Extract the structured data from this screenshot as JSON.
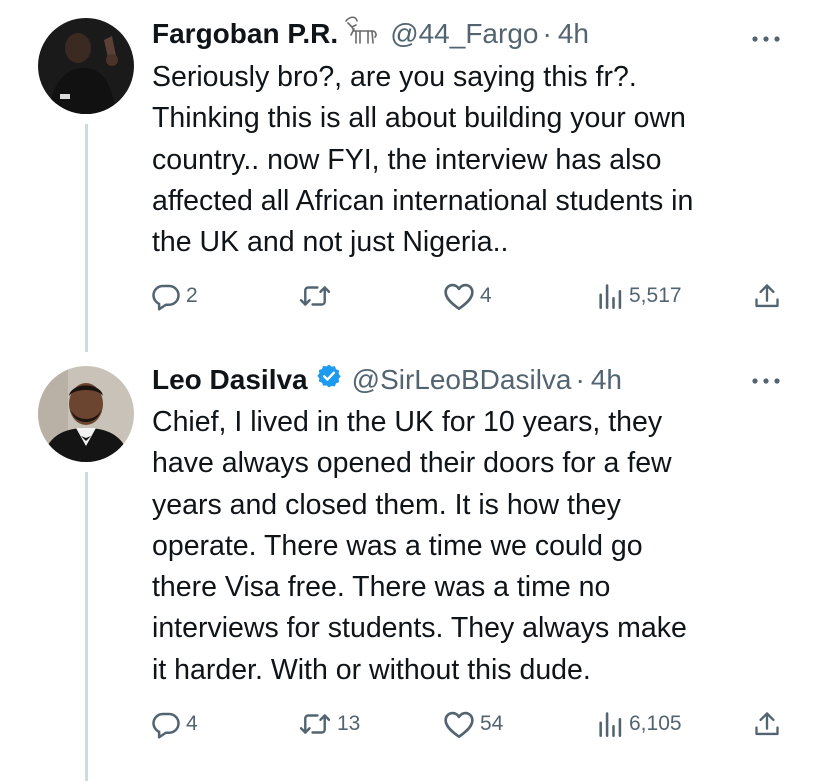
{
  "tweets": [
    {
      "display_name": "Fargoban P.R.",
      "name_emoji": "goat-emoji",
      "handle": "@44_Fargo",
      "separator": "·",
      "time": "4h",
      "text": "Seriously bro?, are you saying this fr?.\nThinking this is all about building your own\ncountry.. now FYI, the interview has also\naffected all African international students in\nthe UK and not just Nigeria..",
      "replies": "2",
      "retweets": "",
      "likes": "4",
      "views": "5,517"
    },
    {
      "display_name": "Leo Dasilva",
      "verified": true,
      "handle": "@SirLeoBDasilva",
      "separator": "·",
      "time": "4h",
      "text": "Chief, I lived in the UK for 10 years, they\nhave always opened their doors for a few\nyears and closed them. It is how they\noperate. There was a time we could go\nthere Visa free. There was a time no\ninterviews for students. They always make\nit harder. With or without this dude.",
      "replies": "4",
      "retweets": "13",
      "likes": "54",
      "views": "6,105"
    }
  ],
  "colors": {
    "text": "#0f1419",
    "secondary": "#536471",
    "verified": "#1d9bf0",
    "thread_line": "#cfd9de"
  },
  "icons": [
    "reply-icon",
    "retweet-icon",
    "like-icon",
    "views-icon",
    "share-icon",
    "more-icon",
    "verified-badge-icon"
  ]
}
